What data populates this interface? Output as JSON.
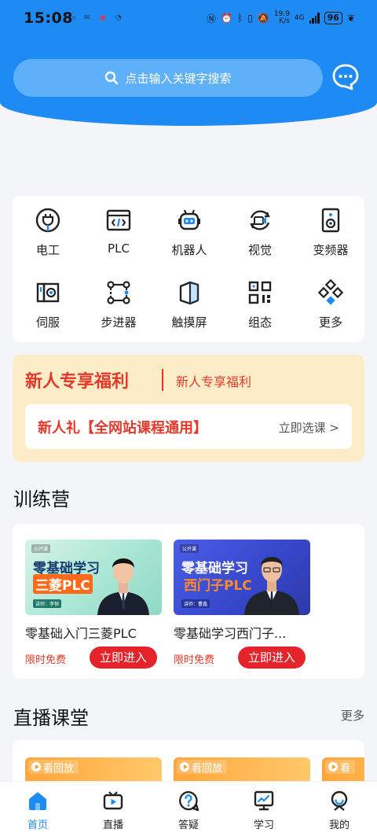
{
  "status_bar": {
    "time": "15:08",
    "net_speed_top": "19.9",
    "net_speed_bottom": "K/s",
    "network": "4G",
    "battery": "96"
  },
  "search": {
    "placeholder": "点击输入关键字搜索"
  },
  "categories": [
    {
      "label": "电工",
      "icon": "plug-icon"
    },
    {
      "label": "PLC",
      "icon": "code-window-icon"
    },
    {
      "label": "机器人",
      "icon": "robot-icon"
    },
    {
      "label": "视觉",
      "icon": "camera-icon"
    },
    {
      "label": "变频器",
      "icon": "speaker-box-icon"
    },
    {
      "label": "伺服",
      "icon": "servo-icon"
    },
    {
      "label": "步进器",
      "icon": "stepper-icon"
    },
    {
      "label": "触摸屏",
      "icon": "touchscreen-icon"
    },
    {
      "label": "组态",
      "icon": "qr-grid-icon"
    },
    {
      "label": "更多",
      "icon": "more-diamond-icon"
    }
  ],
  "promo": {
    "title": "新人专享福利",
    "subtitle": "新人专享福利",
    "gift": "新人礼【全网站课程通用】",
    "link": "立即选课 >"
  },
  "training": {
    "title": "训练营",
    "courses": [
      {
        "thumb_tag": "公开课",
        "thumb_line1": "零基础学习",
        "thumb_line2": "三菱PLC",
        "thumb_teacher": "讲师：李恒",
        "title": "零基础入门三菱PLC",
        "free": "限时免费",
        "button": "立即进入"
      },
      {
        "thumb_tag": "公开课",
        "thumb_line1": "零基础学习",
        "thumb_line2": "西门子PLC",
        "thumb_teacher": "讲师：曹鑫",
        "title": "零基础学习西门子...",
        "free": "限时免费",
        "button": "立即进入"
      }
    ]
  },
  "live": {
    "title": "直播课堂",
    "more": "更多",
    "replay_label": "看回放",
    "replay_short": "看"
  },
  "nav": [
    {
      "label": "首页",
      "icon": "home-icon"
    },
    {
      "label": "直播",
      "icon": "tv-icon"
    },
    {
      "label": "答疑",
      "icon": "question-icon"
    },
    {
      "label": "学习",
      "icon": "monitor-chart-icon"
    },
    {
      "label": "我的",
      "icon": "user-icon"
    }
  ],
  "colors": {
    "primary": "#1e8bf5",
    "accent_red": "#e4232a",
    "promo_bg": "#fcecc8"
  }
}
